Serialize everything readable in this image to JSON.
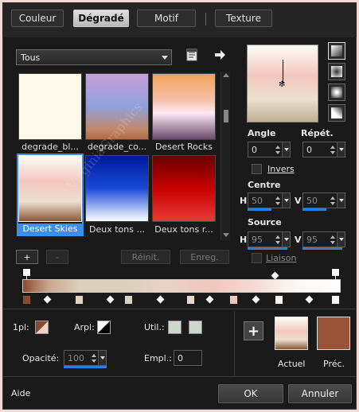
{
  "tabs": [
    {
      "label": "Couleur",
      "active": false
    },
    {
      "label": "Dégradé",
      "active": true
    },
    {
      "label": "Motif",
      "active": false
    },
    {
      "label": "Texture",
      "active": false
    }
  ],
  "filter": {
    "value": "Tous"
  },
  "gradients": [
    {
      "label": "degrade_bl...",
      "selected": false
    },
    {
      "label": "degrade_co...",
      "selected": false
    },
    {
      "label": "Desert Rocks",
      "selected": false
    },
    {
      "label": "Desert Skies",
      "selected": true
    },
    {
      "label": "Deux tons ...",
      "selected": false
    },
    {
      "label": "Deux tons r...",
      "selected": false
    }
  ],
  "list_buttons": {
    "add": "+",
    "remove": "-",
    "reset": "Réinit.",
    "save": "Enreg."
  },
  "angle": {
    "label": "Angle",
    "value": "0"
  },
  "repeat": {
    "label": "Répét.",
    "value": "0"
  },
  "invert": {
    "label": "Invers",
    "checked": false
  },
  "center": {
    "label": "Centre",
    "h_label": "H",
    "h": "50",
    "v_label": "V",
    "v": "50"
  },
  "source": {
    "label": "Source",
    "h_label": "H",
    "h": "95",
    "v_label": "V",
    "v": "95"
  },
  "link": {
    "label": "Liaison",
    "checked": false
  },
  "stop_panel": {
    "onepl_label": "1pl:",
    "arpl_label": "Arpl:",
    "util_label": "Util.:",
    "opacity_label": "Opacité:",
    "opacity_value": "100",
    "position_label": "Empl.:",
    "position_value": "0"
  },
  "preview": {
    "current_label": "Actuel",
    "previous_label": "Préc.",
    "add_symbol": "+"
  },
  "footer": {
    "help": "Aide",
    "ok": "OK",
    "cancel": "Annuler"
  },
  "watermark": "VirginiaGraphics",
  "colors": {
    "accent": "#2f7fd7",
    "selected_label_bg": "#3d8ee8",
    "stop_color_1": "#8a4a2e",
    "previous_swatch": "#9a5538"
  }
}
